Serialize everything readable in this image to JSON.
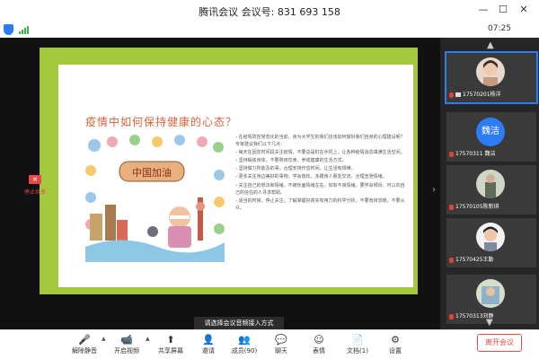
{
  "window": {
    "title": "腾讯会议 会议号: 831 693 158",
    "minimize": "—",
    "maximize": "☐",
    "close": "✕"
  },
  "status": {
    "timer": "07:25"
  },
  "slide": {
    "title": "疫情中如何保持健康的心态？",
    "art_caption": "中国加油",
    "paragraphs": [
      "在疫情防控常态化的当前，身为大学生的我们应该如何做好我们自身的心理建设呢？专家建议我们以下几点：",
      "每天在固定时间段关注疫情，不要总是盯在手机上，让各种疫情消息填满生活空间。",
      "坚持锻炼身体，不要熬夜饮食，养成健康的生活方式。",
      "坚持做力所能及的事，合理安排作息时间，让生活有规律。",
      "更多关注身边美好的事物，学会放松，多跟亲人朋友交流，合理宣泄情绪。",
      "关注自己的想法和情绪，不被负面情绪左右，如有不良情绪，要学会倾诉，可以向自己的信任的人寻求帮助。",
      "适当的时候，停止关注，了解掌握好真实有用力的科学分析，不要盲目恐慌，不要从众。"
    ]
  },
  "share": {
    "stop_label": "停止共享"
  },
  "participants": [
    {
      "name": "17570201杨洋",
      "avatar": "photo",
      "muted": true
    },
    {
      "name": "17570311 魏洁",
      "avatar": "魏洁",
      "muted": true
    },
    {
      "name": "17570105陈新琪",
      "avatar": "photo",
      "muted": true
    },
    {
      "name": "17570425王勤",
      "avatar": "photo",
      "muted": true
    },
    {
      "name": "17570313刘静",
      "avatar": "photo",
      "muted": true
    }
  ],
  "tooltip": "请选择会议音频接入方式",
  "toolbar": {
    "mute": "解除静音",
    "video": "开启视频",
    "share": "共享屏幕",
    "invite": "邀请",
    "members": "成员(90)",
    "chat": "聊天",
    "emoji": "表情",
    "docs": "文档(1)",
    "settings": "设置",
    "leave": "离开会议"
  },
  "colors": {
    "accent": "#2d7cf6",
    "danger": "#e84a4a",
    "slide_border": "#a2c83e"
  }
}
